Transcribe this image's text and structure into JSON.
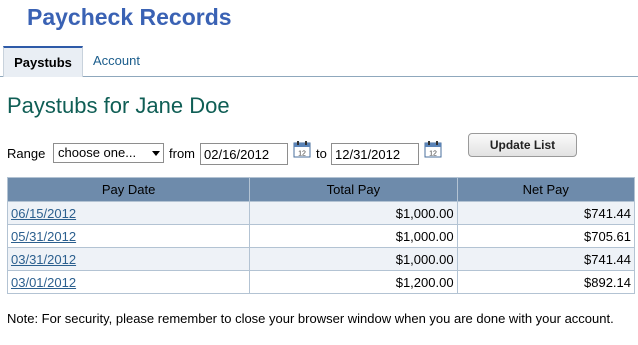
{
  "header": {
    "app_title": "Paycheck Records"
  },
  "tabs": [
    {
      "label": "Paystubs",
      "active": true
    },
    {
      "label": "Account",
      "active": false
    }
  ],
  "main": {
    "page_title": "Paystubs for Jane Doe",
    "filter": {
      "range_label": "Range",
      "range_selected": "choose one...",
      "from_label": "from",
      "from_value": "02/16/2012",
      "to_label": "to",
      "to_value": "12/31/2012",
      "calendar_icon_text": "12",
      "update_button": "Update List"
    },
    "table": {
      "columns": [
        "Pay Date",
        "Total Pay",
        "Net Pay"
      ],
      "rows": [
        {
          "date": "06/15/2012",
          "total": "$1,000.00",
          "net": "$741.44"
        },
        {
          "date": "05/31/2012",
          "total": "$1,000.00",
          "net": "$705.61"
        },
        {
          "date": "03/31/2012",
          "total": "$1,000.00",
          "net": "$741.44"
        },
        {
          "date": "03/01/2012",
          "total": "$1,200.00",
          "net": "$892.14"
        }
      ]
    },
    "note": "Note: For security, please remember to close your browser window when you are done with your account."
  },
  "colors": {
    "title_blue": "#3a62b4",
    "heading_teal": "#0f5e55",
    "table_header": "#6e8bab",
    "link": "#2b5f8e"
  }
}
